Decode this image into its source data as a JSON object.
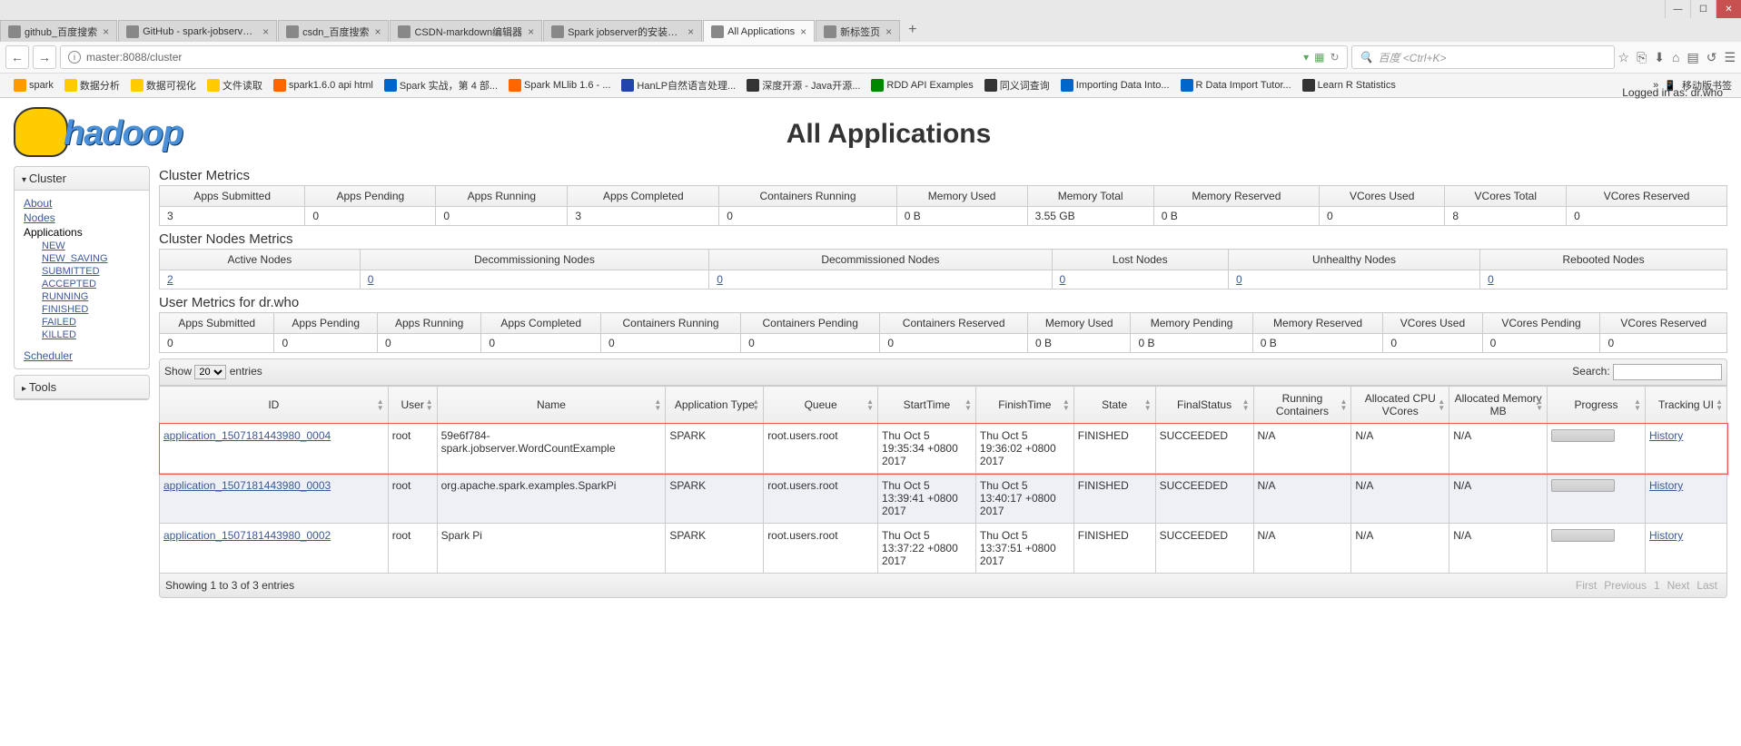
{
  "browser": {
    "tabs": [
      {
        "title": "github_百度搜索"
      },
      {
        "title": "GitHub - spark-jobserver/s"
      },
      {
        "title": "csdn_百度搜索"
      },
      {
        "title": "CSDN-markdown编辑器"
      },
      {
        "title": "Spark jobserver的安装和使用 |"
      },
      {
        "title": "All Applications",
        "active": true
      },
      {
        "title": "新标签页"
      }
    ],
    "url": "master:8088/cluster",
    "search_placeholder": "百度 <Ctrl+K>",
    "bookmarks": [
      {
        "label": "spark",
        "color": "#f90"
      },
      {
        "label": "数据分析",
        "color": "#fc0"
      },
      {
        "label": "数据可视化",
        "color": "#fc0"
      },
      {
        "label": "文件读取",
        "color": "#fc0"
      },
      {
        "label": "spark1.6.0 api html",
        "color": "#f60"
      },
      {
        "label": "Spark 实战，第 4 部...",
        "color": "#06c"
      },
      {
        "label": "Spark MLlib 1.6 - ...",
        "color": "#f60"
      },
      {
        "label": "HanLP自然语言处理...",
        "color": "#24a"
      },
      {
        "label": "深度开源 - Java开源...",
        "color": "#333"
      },
      {
        "label": "RDD API Examples",
        "color": "#080"
      },
      {
        "label": "同义词查询",
        "color": "#333"
      },
      {
        "label": "Importing Data Into...",
        "color": "#06c"
      },
      {
        "label": "R Data Import Tutor...",
        "color": "#06c"
      },
      {
        "label": "Learn R Statistics",
        "color": "#333"
      }
    ],
    "mobile_bookmark": "移动版书签"
  },
  "hadoop": {
    "logo_text": "hadoop",
    "page_title": "All Applications",
    "login": "Logged in as: dr.who",
    "sidebar": {
      "cluster_header": "Cluster",
      "cluster_links": [
        "About",
        "Nodes",
        "Applications"
      ],
      "app_states": [
        "NEW",
        "NEW_SAVING",
        "SUBMITTED",
        "ACCEPTED",
        "RUNNING",
        "FINISHED",
        "FAILED",
        "KILLED"
      ],
      "scheduler": "Scheduler",
      "tools_header": "Tools"
    },
    "cluster_metrics": {
      "title": "Cluster Metrics",
      "headers": [
        "Apps Submitted",
        "Apps Pending",
        "Apps Running",
        "Apps Completed",
        "Containers Running",
        "Memory Used",
        "Memory Total",
        "Memory Reserved",
        "VCores Used",
        "VCores Total",
        "VCores Reserved"
      ],
      "values": [
        "3",
        "0",
        "0",
        "3",
        "0",
        "0 B",
        "3.55 GB",
        "0 B",
        "0",
        "8",
        "0"
      ]
    },
    "node_metrics": {
      "title": "Cluster Nodes Metrics",
      "headers": [
        "Active Nodes",
        "Decommissioning Nodes",
        "Decommissioned Nodes",
        "Lost Nodes",
        "Unhealthy Nodes",
        "Rebooted Nodes"
      ],
      "values": [
        "2",
        "0",
        "0",
        "0",
        "0",
        "0"
      ]
    },
    "user_metrics": {
      "title": "User Metrics for dr.who",
      "headers": [
        "Apps Submitted",
        "Apps Pending",
        "Apps Running",
        "Apps Completed",
        "Containers Running",
        "Containers Pending",
        "Containers Reserved",
        "Memory Used",
        "Memory Pending",
        "Memory Reserved",
        "VCores Used",
        "VCores Pending",
        "VCores Reserved"
      ],
      "values": [
        "0",
        "0",
        "0",
        "0",
        "0",
        "0",
        "0",
        "0 B",
        "0 B",
        "0 B",
        "0",
        "0",
        "0"
      ]
    },
    "apps": {
      "show_label": "Show",
      "entries_label": "entries",
      "page_size": "20",
      "search_label": "Search:",
      "headers": [
        "ID",
        "User",
        "Name",
        "Application Type",
        "Queue",
        "StartTime",
        "FinishTime",
        "State",
        "FinalStatus",
        "Running Containers",
        "Allocated CPU VCores",
        "Allocated Memory MB",
        "Progress",
        "Tracking UI"
      ],
      "rows": [
        {
          "id": "application_1507181443980_0004",
          "user": "root",
          "name": "59e6f784-spark.jobserver.WordCountExample",
          "type": "SPARK",
          "queue": "root.users.root",
          "start": "Thu Oct 5 19:35:34 +0800 2017",
          "finish": "Thu Oct 5 19:36:02 +0800 2017",
          "state": "FINISHED",
          "final": "SUCCEEDED",
          "rc": "N/A",
          "cpu": "N/A",
          "mem": "N/A",
          "track": "History"
        },
        {
          "id": "application_1507181443980_0003",
          "user": "root",
          "name": "org.apache.spark.examples.SparkPi",
          "type": "SPARK",
          "queue": "root.users.root",
          "start": "Thu Oct 5 13:39:41 +0800 2017",
          "finish": "Thu Oct 5 13:40:17 +0800 2017",
          "state": "FINISHED",
          "final": "SUCCEEDED",
          "rc": "N/A",
          "cpu": "N/A",
          "mem": "N/A",
          "track": "History"
        },
        {
          "id": "application_1507181443980_0002",
          "user": "root",
          "name": "Spark Pi",
          "type": "SPARK",
          "queue": "root.users.root",
          "start": "Thu Oct 5 13:37:22 +0800 2017",
          "finish": "Thu Oct 5 13:37:51 +0800 2017",
          "state": "FINISHED",
          "final": "SUCCEEDED",
          "rc": "N/A",
          "cpu": "N/A",
          "mem": "N/A",
          "track": "History"
        }
      ],
      "info": "Showing 1 to 3 of 3 entries",
      "paginate": [
        "First",
        "Previous",
        "1",
        "Next",
        "Last"
      ]
    }
  }
}
